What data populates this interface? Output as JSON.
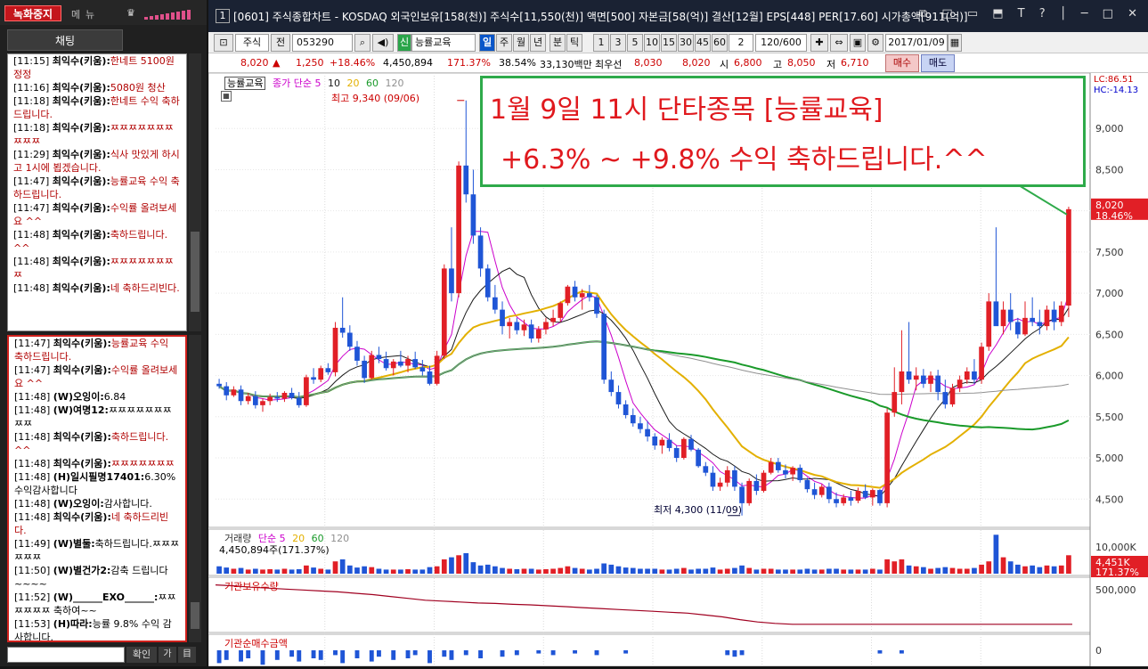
{
  "left_panel": {
    "record_button": "녹화중지",
    "toolbar_icons": [
      "메",
      "뉴",
      "♛"
    ],
    "chat_header": "채팅",
    "messages_top": [
      {
        "time": "[11:15]",
        "name": "최익수(키움):",
        "text": "한네트 5100원 정정"
      },
      {
        "time": "[11:16]",
        "name": "최익수(키움):",
        "text": "5080원 청산"
      },
      {
        "time": "[11:18]",
        "name": "최익수(키움):",
        "text": "한네트 수익 축하드립니다."
      },
      {
        "time": "[11:18]",
        "name": "최익수(키움):",
        "text": "ㅉㅉㅉㅉㅉㅉㅉㅉㅉㅉ"
      },
      {
        "time": "[11:29]",
        "name": "최익수(키움):",
        "text": "식사 맛있게 하시고 1시에 뵙겠습니다."
      },
      {
        "time": "[11:47]",
        "name": "최익수(키움):",
        "text": "능률교육 수익 축하드립니다."
      },
      {
        "time": "[11:47]",
        "name": "최익수(키움):",
        "text": "수익률 올려보세요 ^^"
      },
      {
        "time": "[11:48]",
        "name": "최익수(키움):",
        "text": "축하드립니다. ^^"
      },
      {
        "time": "[11:48]",
        "name": "최익수(키움):",
        "text": "ㅉㅉㅉㅉㅉㅉㅉㅉ"
      },
      {
        "time": "[11:48]",
        "name": "최익수(키움):",
        "text": "네 축하드리빈다."
      }
    ],
    "messages_bottom": [
      {
        "time": "[11:47]",
        "name": "최익수(키움):",
        "text": "능률교육 수익 축하드립니다.",
        "red": true
      },
      {
        "time": "[11:47]",
        "name": "최익수(키움):",
        "text": "수익률 올려보세요 ^^",
        "red": true
      },
      {
        "time": "[11:48]",
        "name": "(W)오잉이:",
        "text": "6.84",
        "red": false
      },
      {
        "time": "[11:48]",
        "name": "(W)여명12:",
        "text": "ㅉㅉㅉㅉㅉㅉㅉㅉㅉ",
        "red": false
      },
      {
        "time": "[11:48]",
        "name": "최익수(키움):",
        "text": "축하드립니다. ^^",
        "red": true
      },
      {
        "time": "[11:48]",
        "name": "최익수(키움):",
        "text": "ㅉㅉㅉㅉㅉㅉㅉ",
        "red": true
      },
      {
        "time": "[11:48]",
        "name": "(H)일시필명17401:",
        "text": "6.30%수익감사합니다",
        "red": false
      },
      {
        "time": "[11:48]",
        "name": "(W)오잉이:",
        "text": "감사합니다.",
        "red": false
      },
      {
        "time": "[11:48]",
        "name": "최익수(키움):",
        "text": "네 축하드리빈다.",
        "red": true
      },
      {
        "time": "[11:49]",
        "name": "(W)별둘:",
        "text": "축하드립니다.ㅉㅉㅉㅉㅉㅉ",
        "red": false
      },
      {
        "time": "[11:50]",
        "name": "(W)별건가2:",
        "text": "감축 드립니다~~~~",
        "red": false
      },
      {
        "time": "[11:52]",
        "name": "(W)______EXO______:",
        "text": "ㅉㅉㅉㅉㅉㅉ 축하여~~",
        "red": false
      },
      {
        "time": "[11:53]",
        "name": "(H)따라:",
        "text": "능률 9.8% 수익 감사합니다.",
        "red": false
      }
    ],
    "send_label": "확인",
    "small_buttons": [
      "가",
      "目"
    ]
  },
  "title_bar": {
    "window_number": "1",
    "title": "[0601] 주식종합차트 - KOSDAQ 외국인보유[158(천)] 주식수[11,550(천)] 액면[500] 자본금[58(억)] 결산[12월] EPS[448] PER[17.60] 시가총액[911(억)]",
    "controls": "⧉ ◱ ▭ ⬒ T ? │ ─ □ ✕"
  },
  "toolbar": {
    "type_select": "주식",
    "prev_label": "전",
    "code": "053290",
    "badge": "신",
    "stock_name": "능률교육",
    "periods": [
      "일",
      "주",
      "월",
      "년",
      "분",
      "틱"
    ],
    "active_period": "일",
    "intervals": [
      "1",
      "3",
      "5",
      "10",
      "15",
      "30",
      "45",
      "60"
    ],
    "interval_select": "2",
    "range": "120/600",
    "date": "2017/01/09"
  },
  "quote": {
    "price": "8,020",
    "arrow": "▲",
    "change": "1,250",
    "change_pct": "+18.46%",
    "volume": "4,450,894",
    "volume_ratio": "171.37%",
    "turnover": "38.54%",
    "amount": "33,130백만",
    "best_ask_label": "최우선",
    "best_ask": "8,030",
    "best_bid": "8,020",
    "open_label": "시",
    "open": "6,800",
    "high_label": "고",
    "high": "8,050",
    "low_label": "저",
    "low": "6,710",
    "buy_label": "매수",
    "sell_label": "매도"
  },
  "overlay": {
    "line1": "1월 9일 11시 단타종목 [능률교육]",
    "line2": "+6.3% ~ +9.8% 수익 축하드립니다.^^"
  },
  "price_pane": {
    "name_tag": "능률교육",
    "ma_label": "종가 단순 5",
    "ma_periods": [
      "10",
      "20",
      "60",
      "120"
    ],
    "ma_colors": [
      "#cc00cc",
      "#1a1a1a",
      "#e3b000",
      "#1a9a2a",
      "#909090"
    ],
    "high_annot": "최고 9,340 (09/06)",
    "low_annot": "최저 4,300 (11/09)",
    "right_top": "LC:86.51",
    "right_top2": "HC:-14.13",
    "last_price": "8,020",
    "last_pct": "18.46%",
    "y_ticks": [
      "9,000",
      "8,500",
      "8,000",
      "7,500",
      "7,000",
      "6,500",
      "6,000",
      "5,500",
      "5,000",
      "4,500"
    ]
  },
  "volume_pane": {
    "title": "거래량",
    "ma_label": "단순 5",
    "ma_periods": [
      "20",
      "60",
      "120"
    ],
    "value": "4,450,894주(171.37%)",
    "y_tick": "10,000K",
    "last": "4,451K",
    "last_pct": "171.37%"
  },
  "inst_pane": {
    "title": "기관보유수량",
    "y_tick": "500,000"
  },
  "inst_net_pane": {
    "title": "기관순매수금액",
    "y_tick": "0"
  },
  "chart_data": {
    "type": "candlestick",
    "title": "능률교육",
    "ylim": [
      4200,
      9500
    ],
    "candles": [
      [
        5900,
        5960,
        5840,
        5870
      ],
      [
        5870,
        5920,
        5700,
        5760
      ],
      [
        5760,
        5870,
        5740,
        5830
      ],
      [
        5830,
        5880,
        5640,
        5690
      ],
      [
        5690,
        5790,
        5650,
        5750
      ],
      [
        5750,
        5810,
        5600,
        5640
      ],
      [
        5640,
        5720,
        5560,
        5690
      ],
      [
        5690,
        5780,
        5640,
        5740
      ],
      [
        5740,
        5800,
        5680,
        5720
      ],
      [
        5720,
        5810,
        5680,
        5790
      ],
      [
        5790,
        5850,
        5710,
        5730
      ],
      [
        5730,
        5800,
        5610,
        5640
      ],
      [
        5640,
        6010,
        5620,
        5980
      ],
      [
        5980,
        6090,
        5900,
        5950
      ],
      [
        5950,
        6120,
        5920,
        6090
      ],
      [
        6090,
        6150,
        6010,
        6040
      ],
      [
        6040,
        6650,
        5990,
        6580
      ],
      [
        6580,
        6950,
        6460,
        6520
      ],
      [
        6520,
        6610,
        6300,
        6350
      ],
      [
        6350,
        6420,
        6120,
        6180
      ],
      [
        6180,
        6240,
        5910,
        5970
      ],
      [
        5970,
        6300,
        5950,
        6250
      ],
      [
        6250,
        6350,
        6150,
        6200
      ],
      [
        6200,
        6290,
        6060,
        6090
      ],
      [
        6090,
        6200,
        6000,
        6170
      ],
      [
        6170,
        6300,
        6100,
        6120
      ],
      [
        6120,
        6240,
        6040,
        6200
      ],
      [
        6200,
        6290,
        6080,
        6100
      ],
      [
        6100,
        6190,
        6000,
        6050
      ],
      [
        6050,
        6120,
        5880,
        5900
      ],
      [
        5900,
        6300,
        5880,
        6240
      ],
      [
        6240,
        7350,
        6200,
        7300
      ],
      [
        7300,
        7800,
        6900,
        7000
      ],
      [
        7000,
        8600,
        6950,
        8550
      ],
      [
        8550,
        9340,
        8100,
        8200
      ],
      [
        8200,
        8500,
        7600,
        7700
      ],
      [
        7700,
        7800,
        7200,
        7300
      ],
      [
        7300,
        7350,
        6900,
        6950
      ],
      [
        6950,
        7100,
        6750,
        6800
      ],
      [
        6800,
        6900,
        6500,
        6600
      ],
      [
        6600,
        6700,
        6450,
        6650
      ],
      [
        6650,
        6700,
        6500,
        6550
      ],
      [
        6550,
        6680,
        6480,
        6620
      ],
      [
        6620,
        6680,
        6400,
        6450
      ],
      [
        6450,
        6600,
        6400,
        6560
      ],
      [
        6560,
        6700,
        6500,
        6650
      ],
      [
        6650,
        6800,
        6600,
        6700
      ],
      [
        6700,
        6900,
        6650,
        6880
      ],
      [
        6880,
        7100,
        6850,
        7080
      ],
      [
        7080,
        7150,
        6900,
        6950
      ],
      [
        6950,
        7050,
        6800,
        7000
      ],
      [
        7000,
        7100,
        6900,
        6950
      ],
      [
        6950,
        6980,
        6700,
        6750
      ],
      [
        6750,
        6800,
        5900,
        5950
      ],
      [
        5950,
        6050,
        5750,
        5800
      ],
      [
        5800,
        5880,
        5600,
        5650
      ],
      [
        5650,
        5700,
        5480,
        5520
      ],
      [
        5520,
        5600,
        5380,
        5420
      ],
      [
        5420,
        5500,
        5300,
        5350
      ],
      [
        5350,
        5450,
        5200,
        5260
      ],
      [
        5260,
        5300,
        5100,
        5150
      ],
      [
        5150,
        5250,
        5050,
        5220
      ],
      [
        5220,
        5300,
        5080,
        5120
      ],
      [
        5120,
        5150,
        4950,
        5000
      ],
      [
        5000,
        5250,
        4980,
        5230
      ],
      [
        5230,
        5280,
        5080,
        5100
      ],
      [
        5100,
        5120,
        4880,
        4900
      ],
      [
        4900,
        4950,
        4780,
        4820
      ],
      [
        4820,
        4900,
        4600,
        4650
      ],
      [
        4650,
        4760,
        4600,
        4700
      ],
      [
        4700,
        4900,
        4650,
        4850
      ],
      [
        4850,
        4900,
        4600,
        4650
      ],
      [
        4650,
        4700,
        4300,
        4450
      ],
      [
        4450,
        4750,
        4420,
        4720
      ],
      [
        4720,
        4800,
        4550,
        4600
      ],
      [
        4600,
        4850,
        4580,
        4820
      ],
      [
        4820,
        5000,
        4800,
        4950
      ],
      [
        4950,
        5000,
        4820,
        4850
      ],
      [
        4850,
        4920,
        4750,
        4800
      ],
      [
        4800,
        4900,
        4720,
        4880
      ],
      [
        4880,
        4920,
        4700,
        4730
      ],
      [
        4730,
        4760,
        4580,
        4620
      ],
      [
        4620,
        4700,
        4500,
        4550
      ],
      [
        4550,
        4680,
        4520,
        4650
      ],
      [
        4650,
        4700,
        4450,
        4500
      ],
      [
        4500,
        4580,
        4400,
        4450
      ],
      [
        4450,
        4560,
        4420,
        4520
      ],
      [
        4520,
        4600,
        4420,
        4480
      ],
      [
        4480,
        4640,
        4450,
        4600
      ],
      [
        4600,
        4680,
        4500,
        4520
      ],
      [
        4520,
        4630,
        4420,
        4610
      ],
      [
        4610,
        4620,
        4420,
        4450
      ],
      [
        4450,
        5600,
        4400,
        5550
      ],
      [
        5550,
        6100,
        5500,
        5800
      ],
      [
        5800,
        6550,
        5650,
        6050
      ],
      [
        6050,
        6650,
        5900,
        5950
      ],
      [
        5950,
        6100,
        5820,
        6000
      ],
      [
        6000,
        6080,
        5850,
        5900
      ],
      [
        5900,
        6050,
        5800,
        6000
      ],
      [
        6000,
        6070,
        5700,
        5800
      ],
      [
        5800,
        5950,
        5600,
        5650
      ],
      [
        5650,
        5900,
        5620,
        5850
      ],
      [
        5850,
        6000,
        5800,
        5950
      ],
      [
        5950,
        6100,
        5900,
        6050
      ],
      [
        6050,
        6200,
        5900,
        5950
      ],
      [
        5950,
        6400,
        5900,
        6350
      ],
      [
        6350,
        7000,
        6300,
        6900
      ],
      [
        6900,
        7800,
        6800,
        6600
      ],
      [
        6600,
        6900,
        6500,
        6800
      ],
      [
        6800,
        7000,
        6550,
        6650
      ],
      [
        6650,
        6700,
        6450,
        6500
      ],
      [
        6500,
        6900,
        6480,
        6700
      ],
      [
        6700,
        6950,
        6600,
        6650
      ],
      [
        6650,
        6800,
        6500,
        6600
      ],
      [
        6600,
        6850,
        6550,
        6800
      ],
      [
        6800,
        6900,
        6550,
        6650
      ],
      [
        6650,
        6900,
        6600,
        6850
      ],
      [
        6850,
        8050,
        6710,
        8020
      ]
    ],
    "volume_relative": [
      0.18,
      0.15,
      0.12,
      0.14,
      0.1,
      0.12,
      0.1,
      0.11,
      0.1,
      0.12,
      0.1,
      0.11,
      0.2,
      0.15,
      0.12,
      0.1,
      0.3,
      0.35,
      0.2,
      0.15,
      0.18,
      0.16,
      0.12,
      0.1,
      0.1,
      0.1,
      0.11,
      0.1,
      0.1,
      0.16,
      0.18,
      0.35,
      0.4,
      0.45,
      0.5,
      0.28,
      0.2,
      0.22,
      0.18,
      0.14,
      0.12,
      0.11,
      0.12,
      0.12,
      0.1,
      0.11,
      0.12,
      0.14,
      0.18,
      0.14,
      0.12,
      0.1,
      0.12,
      0.25,
      0.22,
      0.18,
      0.15,
      0.14,
      0.12,
      0.12,
      0.12,
      0.1,
      0.1,
      0.12,
      0.14,
      0.1,
      0.12,
      0.12,
      0.15,
      0.1,
      0.12,
      0.14,
      0.2,
      0.14,
      0.1,
      0.12,
      0.12,
      0.1,
      0.1,
      0.1,
      0.1,
      0.12,
      0.1,
      0.1,
      0.12,
      0.12,
      0.1,
      0.1,
      0.1,
      0.1,
      0.12,
      0.1,
      0.35,
      0.3,
      0.35,
      0.2,
      0.18,
      0.16,
      0.12,
      0.14,
      0.16,
      0.14,
      0.12,
      0.12,
      0.14,
      0.22,
      0.3,
      0.95,
      0.4,
      0.3,
      0.22,
      0.18,
      0.2,
      0.16,
      0.2,
      0.18,
      0.2,
      0.45
    ],
    "inst_holding_relative": [
      0.95,
      0.93,
      0.9,
      0.88,
      0.86,
      0.84,
      0.82,
      0.8,
      0.77,
      0.74,
      0.7,
      0.66,
      0.62,
      0.6,
      0.58,
      0.56,
      0.55,
      0.53,
      0.52,
      0.5,
      0.48,
      0.46,
      0.44,
      0.42,
      0.4,
      0.38,
      0.36,
      0.34,
      0.3,
      0.26,
      0.2,
      0.15,
      0.12,
      0.1,
      0.1,
      0.1,
      0.1,
      0.1,
      0.1,
      0.1,
      0.1,
      0.1,
      0.1,
      0.1,
      0.1,
      0.1,
      0.1,
      0.1,
      0.1,
      0.1
    ],
    "inst_net_relative": [
      0.8,
      0.6,
      0.0,
      0.7,
      0.5,
      0.0,
      0.9,
      0.0,
      0.6,
      0.0,
      0.4,
      0.7,
      0.0,
      0.5,
      0.6,
      0.0,
      0.3,
      0.8,
      0.0,
      0.5,
      0.0,
      0.7,
      0.4,
      0.0,
      0.6,
      0.0,
      0.5,
      0.3,
      0.0,
      0.8,
      0.0,
      0.4,
      0.6,
      0.0,
      0.3,
      0.0,
      0.5,
      0.0,
      0.0,
      0.4,
      0.0,
      0.3,
      0.0,
      0.0,
      0.2,
      0.0,
      0.3,
      0.0,
      0.0,
      0.2,
      0.0,
      0.0,
      0.3,
      0.0,
      0.0,
      0.0,
      0.2,
      0.0,
      0.0,
      0.0,
      0.0,
      0.0,
      0.0,
      0.0,
      0.0,
      0.0,
      0.0,
      0.0,
      0.0,
      0.0,
      0.3,
      0.4,
      0.3,
      0.0,
      0.0,
      0.0,
      0.0,
      0.0,
      0.0,
      0.0,
      0.0,
      0.0,
      0.0,
      0.0,
      0.0,
      0.0,
      0.0,
      0.0,
      0.0,
      0.0,
      0.0,
      0.2,
      0.0,
      0.0,
      0.2,
      0.0,
      0.0,
      0.0,
      0.0,
      0.0,
      0.0,
      0.0,
      0.0,
      0.0,
      0.0,
      0.0,
      0.0,
      0.0,
      0.0,
      0.0,
      0.0,
      0.0,
      0.0,
      0.0,
      0.0,
      0.0,
      0.0,
      0.0
    ]
  }
}
